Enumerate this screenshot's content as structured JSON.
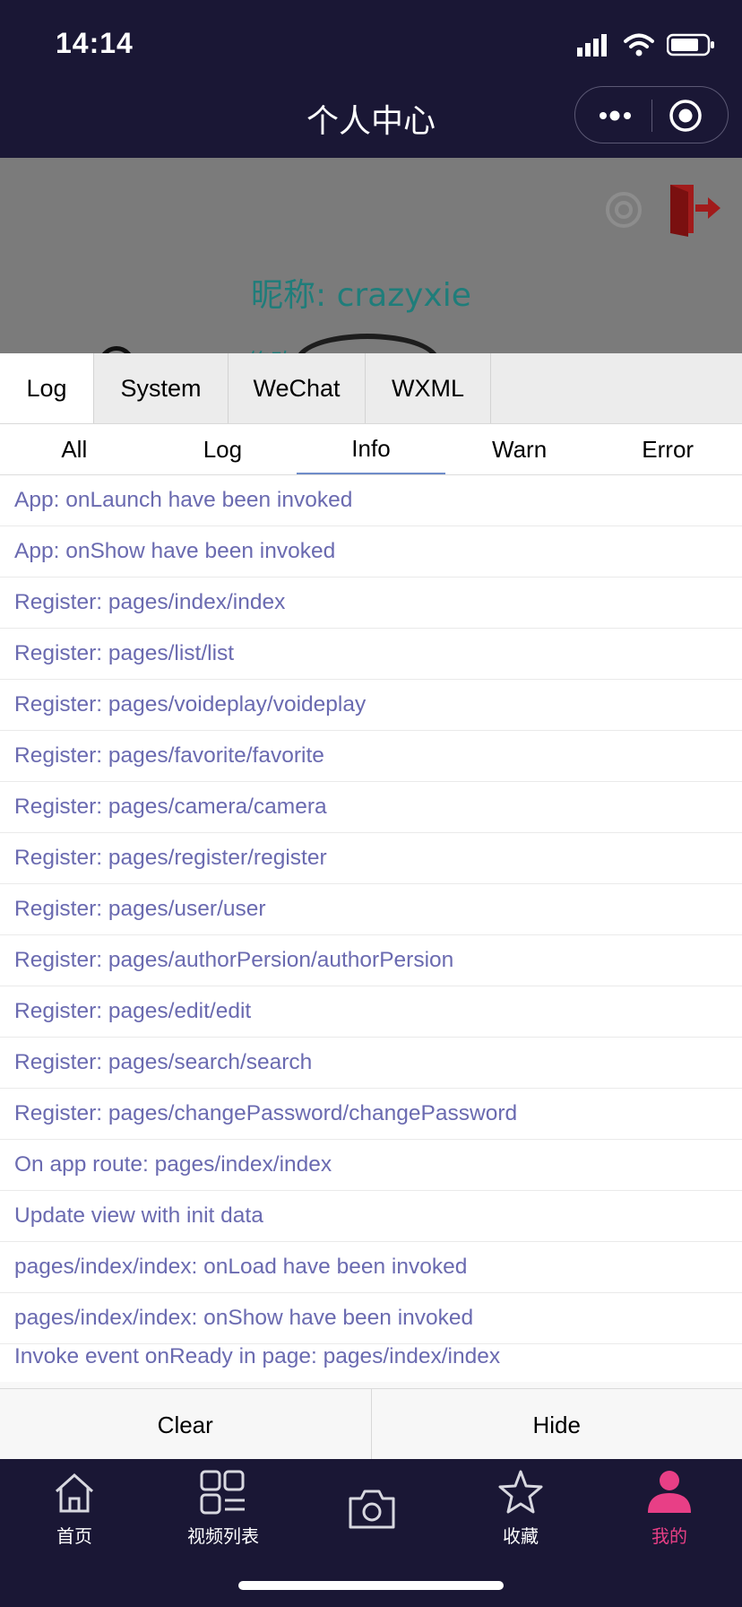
{
  "status_bar": {
    "time": "14:14"
  },
  "nav": {
    "title": "个人中心"
  },
  "profile": {
    "nickname": "昵称: crazyxie",
    "partial": "修改"
  },
  "console": {
    "tabs": [
      "Log",
      "System",
      "WeChat",
      "WXML"
    ],
    "active_tab": "Log",
    "subtabs": [
      "All",
      "Log",
      "Info",
      "Warn",
      "Error"
    ],
    "active_subtab": "Info",
    "logs": [
      "App: onLaunch have been invoked",
      "App: onShow have been invoked",
      "Register: pages/index/index",
      "Register: pages/list/list",
      "Register: pages/voideplay/voideplay",
      "Register: pages/favorite/favorite",
      "Register: pages/camera/camera",
      "Register: pages/register/register",
      "Register: pages/user/user",
      "Register: pages/authorPersion/authorPersion",
      "Register: pages/edit/edit",
      "Register: pages/search/search",
      "Register: pages/changePassword/changePassword",
      "On app route: pages/index/index",
      "Update view with init data",
      "pages/index/index: onLoad have been invoked",
      "pages/index/index: onShow have been invoked",
      "Invoke event onReady in page: pages/index/index"
    ],
    "actions": {
      "clear": "Clear",
      "hide": "Hide"
    }
  },
  "tabbar": {
    "items": [
      {
        "label": "首页",
        "icon": "home-icon"
      },
      {
        "label": "视频列表",
        "icon": "video-list-icon"
      },
      {
        "label": "",
        "icon": "camera-icon"
      },
      {
        "label": "收藏",
        "icon": "star-icon"
      },
      {
        "label": "我的",
        "icon": "user-icon"
      }
    ],
    "active_color": "#e83f86"
  },
  "colors": {
    "bar_bg": "#1a1735",
    "log_text": "#6a6ab0",
    "accent_underline": "#6f8cc9"
  }
}
